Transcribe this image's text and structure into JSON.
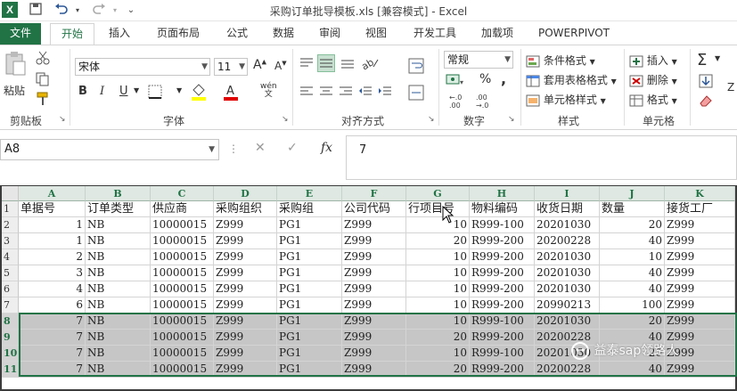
{
  "titlebar": {
    "app_icon": "X",
    "title": "采购订单批导模板.xls  [兼容模式] - Excel",
    "qat": [
      "save-icon",
      "undo-icon",
      "redo-icon",
      "customize-icon"
    ]
  },
  "tabs": [
    "文件",
    "开始",
    "插入",
    "页面布局",
    "公式",
    "数据",
    "审阅",
    "视图",
    "开发工具",
    "加载项",
    "POWERPIVOT"
  ],
  "active_tab": "开始",
  "ribbon": {
    "clipboard": {
      "label": "剪贴板",
      "paste": "粘贴"
    },
    "font": {
      "label": "字体",
      "family": "宋体",
      "size": "11",
      "bold": "B",
      "italic": "I",
      "underline": "U",
      "phonetic": "wén"
    },
    "alignment": {
      "label": "对齐方式"
    },
    "number": {
      "label": "数字",
      "format": "常规",
      "percent": "%",
      "comma": ","
    },
    "styles": {
      "label": "样式",
      "conditional": "条件格式",
      "table": "套用表格格式",
      "cell": "单元格样式"
    },
    "cells": {
      "label": "单元格",
      "insert": "插入",
      "delete": "删除",
      "format": "格式"
    },
    "editing": {
      "sigma": "Σ"
    }
  },
  "formula_bar": {
    "name_box": "A8",
    "cancel": "✕",
    "enter": "✓",
    "fx": "fx",
    "value": "7"
  },
  "sheet": {
    "columns": [
      "A",
      "B",
      "C",
      "D",
      "E",
      "F",
      "G",
      "H",
      "I",
      "J",
      "K"
    ],
    "rows": [
      {
        "n": "1",
        "c": [
          "单据号",
          "订单类型",
          "供应商",
          "采购组织",
          "采购组",
          "公司代码",
          "行项目号",
          "物料编码",
          "收货日期",
          "数量",
          "接货工厂"
        ]
      },
      {
        "n": "2",
        "c": [
          "1",
          "NB",
          "10000015",
          "Z999",
          "PG1",
          "Z999",
          "10",
          "R999-100",
          "20201030",
          "20",
          "Z999"
        ]
      },
      {
        "n": "3",
        "c": [
          "1",
          "NB",
          "10000015",
          "Z999",
          "PG1",
          "Z999",
          "20",
          "R999-200",
          "20200228",
          "40",
          "Z999"
        ]
      },
      {
        "n": "4",
        "c": [
          "2",
          "NB",
          "10000015",
          "Z999",
          "PG1",
          "Z999",
          "10",
          "R999-200",
          "20201030",
          "10",
          "Z999"
        ]
      },
      {
        "n": "5",
        "c": [
          "3",
          "NB",
          "10000015",
          "Z999",
          "PG1",
          "Z999",
          "10",
          "R999-200",
          "20201030",
          "40",
          "Z999"
        ]
      },
      {
        "n": "6",
        "c": [
          "4",
          "NB",
          "10000015",
          "Z999",
          "PG1",
          "Z999",
          "10",
          "R999-200",
          "20201030",
          "40",
          "Z999"
        ]
      },
      {
        "n": "7",
        "c": [
          "6",
          "NB",
          "10000015",
          "Z999",
          "PG1",
          "Z999",
          "10",
          "R999-200",
          "20990213",
          "100",
          "Z999"
        ]
      },
      {
        "n": "8",
        "c": [
          "7",
          "NB",
          "10000015",
          "Z999",
          "PG1",
          "Z999",
          "10",
          "R999-100",
          "20201030",
          "20",
          "Z999"
        ]
      },
      {
        "n": "9",
        "c": [
          "7",
          "NB",
          "10000015",
          "Z999",
          "PG1",
          "Z999",
          "20",
          "R999-200",
          "20200228",
          "40",
          "Z999"
        ]
      },
      {
        "n": "10",
        "c": [
          "7",
          "NB",
          "10000015",
          "Z999",
          "PG1",
          "Z999",
          "10",
          "R999-100",
          "20201030",
          "20",
          "Z999"
        ]
      },
      {
        "n": "11",
        "c": [
          "7",
          "NB",
          "10000015",
          "Z999",
          "PG1",
          "Z999",
          "20",
          "R999-200",
          "20200228",
          "40",
          "Z999"
        ]
      }
    ],
    "selected_rows": [
      "8",
      "9",
      "10",
      "11"
    ]
  },
  "watermark": "益泰sap领路人",
  "colors": {
    "excel_green": "#217346",
    "selection": "#c6c6c6"
  }
}
